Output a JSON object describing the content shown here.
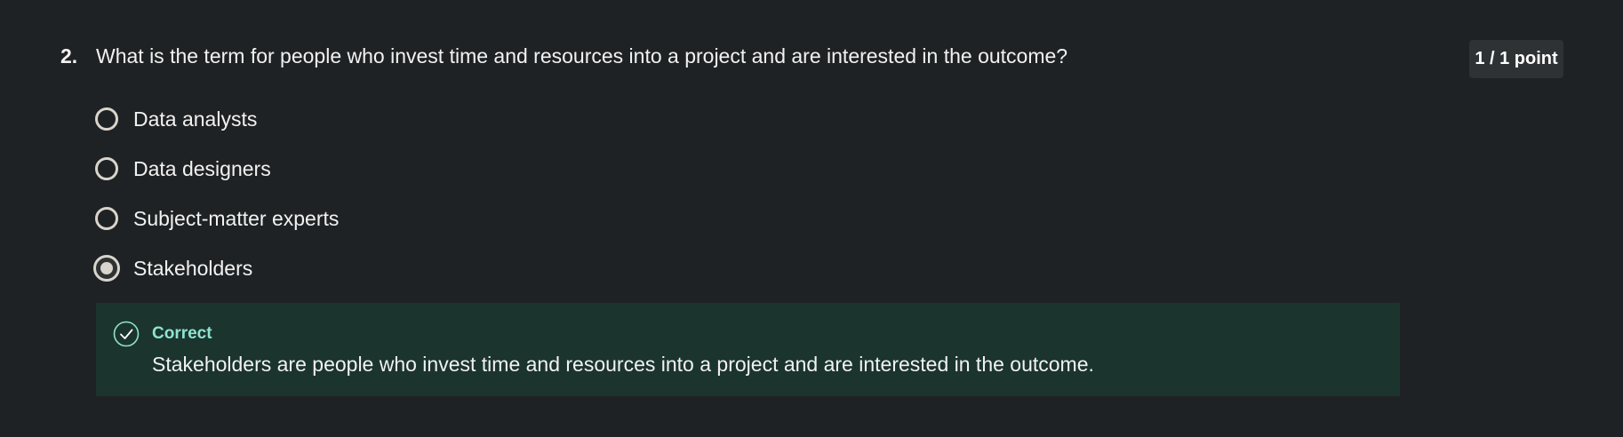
{
  "question": {
    "number": "2.",
    "text": "What is the term for people who invest time and resources into a project and are interested in the outcome?",
    "points": "1 / 1 point"
  },
  "options": [
    {
      "label": "Data analysts",
      "selected": false
    },
    {
      "label": "Data designers",
      "selected": false
    },
    {
      "label": "Subject-matter experts",
      "selected": false
    },
    {
      "label": "Stakeholders",
      "selected": true
    }
  ],
  "feedback": {
    "status": "Correct",
    "icon": "check-circle-icon",
    "message": "Stakeholders are people who invest time and resources into a project and are interested in the outcome."
  },
  "colors": {
    "background": "#1f2224",
    "feedback_background": "#1b342e",
    "correct_accent": "#8fe3cf"
  }
}
